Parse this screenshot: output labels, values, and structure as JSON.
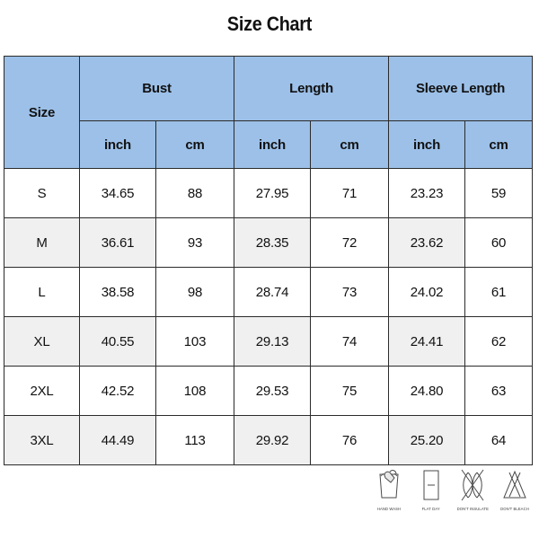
{
  "title": "Size Chart",
  "table": {
    "size_header": "Size",
    "groups": [
      {
        "label": "Bust",
        "units": [
          "inch",
          "cm"
        ]
      },
      {
        "label": "Length",
        "units": [
          "inch",
          "cm"
        ]
      },
      {
        "label": "Sleeve Length",
        "units": [
          "inch",
          "cm"
        ]
      }
    ],
    "rows": [
      {
        "size": "S",
        "bust_inch": "34.65",
        "bust_cm": "88",
        "length_inch": "27.95",
        "length_cm": "71",
        "sleeve_inch": "23.23",
        "sleeve_cm": "59"
      },
      {
        "size": "M",
        "bust_inch": "36.61",
        "bust_cm": "93",
        "length_inch": "28.35",
        "length_cm": "72",
        "sleeve_inch": "23.62",
        "sleeve_cm": "60"
      },
      {
        "size": "L",
        "bust_inch": "38.58",
        "bust_cm": "98",
        "length_inch": "28.74",
        "length_cm": "73",
        "sleeve_inch": "24.02",
        "sleeve_cm": "61"
      },
      {
        "size": "XL",
        "bust_inch": "40.55",
        "bust_cm": "103",
        "length_inch": "29.13",
        "length_cm": "74",
        "sleeve_inch": "24.41",
        "sleeve_cm": "62"
      },
      {
        "size": "2XL",
        "bust_inch": "42.52",
        "bust_cm": "108",
        "length_inch": "29.53",
        "length_cm": "75",
        "sleeve_inch": "24.80",
        "sleeve_cm": "63"
      },
      {
        "size": "3XL",
        "bust_inch": "44.49",
        "bust_cm": "113",
        "length_inch": "29.92",
        "length_cm": "76",
        "sleeve_inch": "25.20",
        "sleeve_cm": "64"
      }
    ]
  },
  "care_symbols": [
    {
      "icon": "hand-wash-icon",
      "label": "HAND WASH"
    },
    {
      "icon": "flat-dry-icon",
      "label": "FLAT DAY"
    },
    {
      "icon": "dont-wring-icon",
      "label": "DON'T INSULATE"
    },
    {
      "icon": "dont-bleach-icon",
      "label": "DON'T BLEACH"
    }
  ],
  "colors": {
    "header_blue": "#9cc0e8",
    "row_shade": "#f0f0f0",
    "border": "#2b2b2b",
    "text": "#111111",
    "background": "#ffffff"
  }
}
